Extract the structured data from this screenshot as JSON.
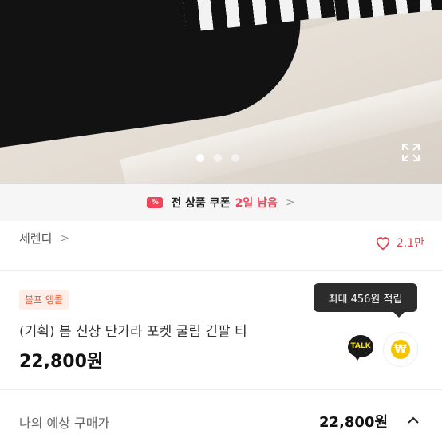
{
  "gallery": {
    "dot_count": 3,
    "active_index": 0
  },
  "coupon": {
    "prefix": "전 상품 쿠폰",
    "highlight": "2일 남음",
    "chevron": ">"
  },
  "shop": {
    "name": "세렌디",
    "chevron": ">"
  },
  "likes": {
    "count": "2.1만"
  },
  "product": {
    "badge": "블프 앵콜",
    "title": "(기획) 봄 신상 단가라 포켓 굴림 긴팔 티",
    "price": "22,800원"
  },
  "reward": {
    "tooltip": "최대 456원 적립",
    "talk_label": "TALK",
    "coin_symbol": "₩"
  },
  "summary": {
    "label": "나의 예상 구매가",
    "amount": "22,800원"
  },
  "colors": {
    "accent": "#f0455a",
    "heart": "#e04555",
    "badge_text": "#f0552a",
    "coin": "#f5c400"
  }
}
